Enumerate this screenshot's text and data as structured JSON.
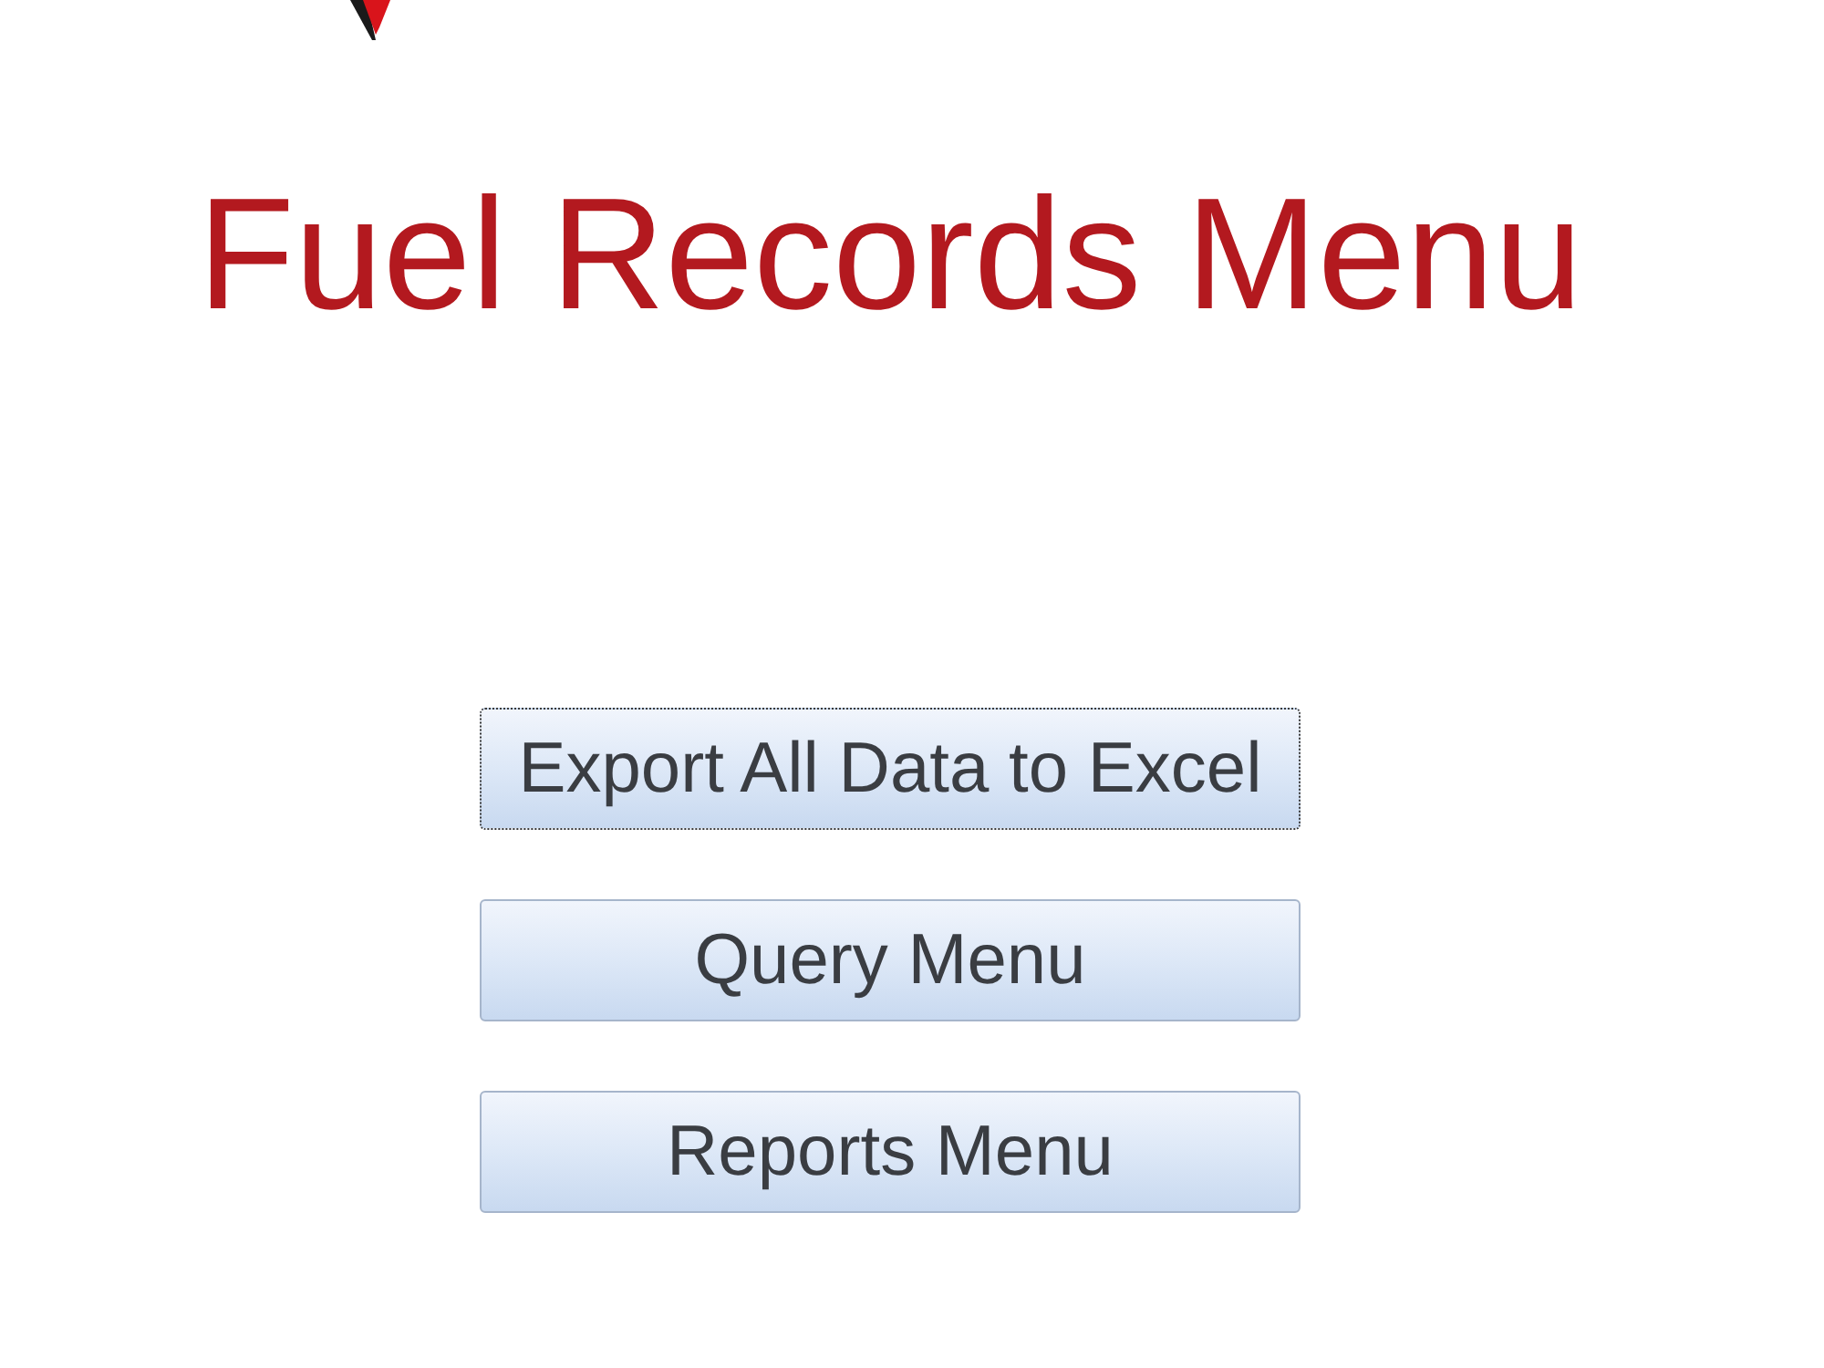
{
  "title": "Fuel Records Menu",
  "buttons": [
    {
      "label": "Export All Data to Excel",
      "focused": true
    },
    {
      "label": "Query Menu",
      "focused": false
    },
    {
      "label": "Reports Menu",
      "focused": false
    }
  ]
}
